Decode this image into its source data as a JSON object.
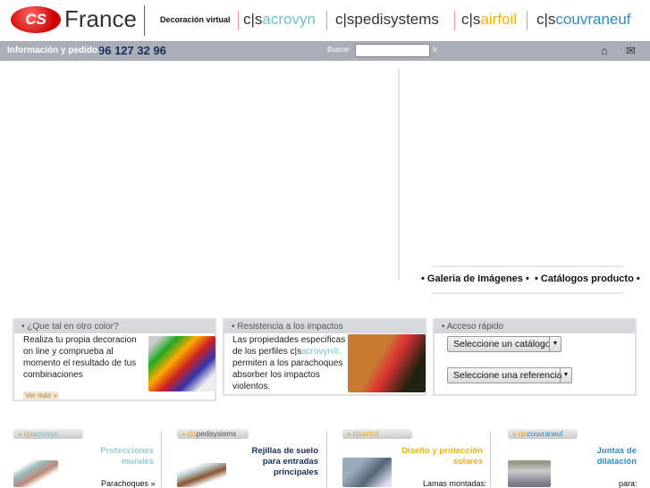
{
  "header": {
    "logo_badge": "CS",
    "logo_text": "France",
    "nav_decoracion": "Decoración virtual",
    "brands": [
      {
        "prefix": "c|s",
        "name": "acrovyn",
        "color": "#6fc3c8"
      },
      {
        "prefix": "c|s",
        "name": "pedisystems",
        "color": "#222222"
      },
      {
        "prefix": "c|s",
        "name": "airfoil",
        "color": "#f2b010"
      },
      {
        "prefix": "c|s",
        "name": "couvraneuf",
        "color": "#2a8ccc"
      }
    ]
  },
  "infobar": {
    "label": "Información y pedidos:",
    "phone": "96 127 32 96",
    "search_label": "Buscar",
    "search_value": "",
    "go_label": "Ir",
    "home_icon": "home-icon",
    "mail_icon": "mail-icon"
  },
  "links": {
    "gallery": "• Galeria de Imágenes •",
    "catalogs": "• Catálogos producto •"
  },
  "panels": [
    {
      "title": "• ¿Que tal en otro color?",
      "text": [
        "Realiza tu propia decoracion",
        "on line y comprueba al",
        "momento el resultado de tus",
        "combinaciones"
      ],
      "more": "Ver más »"
    },
    {
      "title": "• Resistencia a los impactos",
      "text": [
        "Las propiedades especificas",
        "de los perfiles c|s",
        "permiten a los parachoques",
        "absorber los impactos",
        "violentos."
      ],
      "brand": "acrovyn®,"
    },
    {
      "title": "• Acceso rápido",
      "select1": "Seleccione un catálogo",
      "select2": "Seleccione una referencia"
    }
  ],
  "categories": [
    {
      "tab_prefix": "» c|s",
      "tab": "acrovyn",
      "title": [
        "Protecciones",
        "murales"
      ],
      "color": "#8fcfcf",
      "sub": "Parachoques »"
    },
    {
      "tab_prefix": "» c|s",
      "tab": "pedisystems",
      "title": [
        "Rejillas de suelo",
        "para entradas",
        "principales"
      ],
      "color": "#1a2e5a",
      "sub": ""
    },
    {
      "tab_prefix": "» c|s",
      "tab": "airfoil",
      "title": [
        "Diseño y protección",
        "solares"
      ],
      "color": "#f2b010",
      "sub": "Lamas montadas:"
    },
    {
      "tab_prefix": "» c|s",
      "tab": "couvraneuf",
      "title": [
        "Juntas de",
        "dilatación"
      ],
      "color": "#2a8ccc",
      "sub": "para:"
    }
  ]
}
